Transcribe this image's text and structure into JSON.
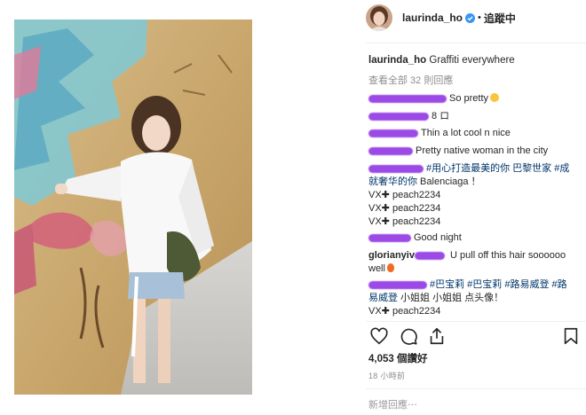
{
  "post": {
    "username": "laurinda_ho",
    "follow_status": "追蹤中",
    "caption_user": "laurinda_ho",
    "caption_text": "Graffiti everywhere",
    "view_all_comments": "查看全部 32 則回應",
    "comments": [
      {
        "text": "So pretty",
        "emoji": "smile-emoji"
      },
      {
        "text": "8 ロ"
      },
      {
        "text": "Thin a lot cool n nice"
      },
      {
        "text": "Pretty native woman in the city"
      },
      {
        "hashtags1": "#用心打造最美的你 巴黎世家 #成",
        "line2_tag": "就奢华的你",
        "line2_text": " Balenciaga ！",
        "extra": [
          "VX✚ peach2234",
          "VX✚ peach2234",
          "VX✚ peach2234"
        ]
      },
      {
        "text": "Good night"
      },
      {
        "user_partial": "glorianyiv",
        "text": "U pull off this hair soooooo",
        "line2": "well",
        "emoji": "fire-emoji"
      },
      {
        "line1": "#巴宝莉 #巴宝莉 #路易威登 #路",
        "line2_tag": "易威登",
        "line2_text": " 小姐姐 小姐姐 点头像！",
        "line3": "VX✚ peach2234"
      }
    ],
    "likes": "4,053 個讚好",
    "timestamp": "18 小時前",
    "add_comment_placeholder": "新增回應⋯"
  },
  "colors": {
    "blur_mask": "#8a2be2",
    "hashtag": "#003569",
    "verified": "#3897f0",
    "muted": "#8e8e8e"
  }
}
